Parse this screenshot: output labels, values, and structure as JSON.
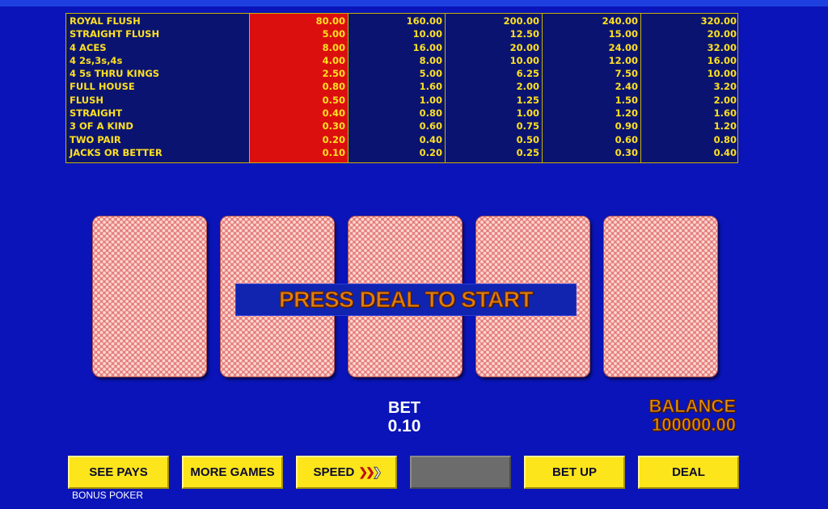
{
  "paytable": {
    "hands": [
      "ROYAL FLUSH",
      "STRAIGHT FLUSH",
      "4 ACES",
      "4 2s,3s,4s",
      "4 5s THRU KINGS",
      "FULL HOUSE",
      "FLUSH",
      "STRAIGHT",
      "3 OF A KIND",
      "TWO PAIR",
      "JACKS OR BETTER"
    ],
    "columns": [
      [
        "80.00",
        "5.00",
        "8.00",
        "4.00",
        "2.50",
        "0.80",
        "0.50",
        "0.40",
        "0.30",
        "0.20",
        "0.10"
      ],
      [
        "160.00",
        "10.00",
        "16.00",
        "8.00",
        "5.00",
        "1.60",
        "1.00",
        "0.80",
        "0.60",
        "0.40",
        "0.20"
      ],
      [
        "200.00",
        "12.50",
        "20.00",
        "10.00",
        "6.25",
        "2.00",
        "1.25",
        "1.00",
        "0.75",
        "0.50",
        "0.25"
      ],
      [
        "240.00",
        "15.00",
        "24.00",
        "12.00",
        "7.50",
        "2.40",
        "1.50",
        "1.20",
        "0.90",
        "0.60",
        "0.30"
      ],
      [
        "320.00",
        "20.00",
        "32.00",
        "16.00",
        "10.00",
        "3.20",
        "2.00",
        "1.60",
        "1.20",
        "0.80",
        "0.40"
      ]
    ],
    "active_column": 0,
    "colors": {
      "text": "#ffe020",
      "background": "#0a1470",
      "active": "#dc0f0f"
    }
  },
  "message": "PRESS DEAL TO START",
  "bet": {
    "label": "BET",
    "value": "0.10"
  },
  "balance": {
    "label": "BALANCE",
    "value": "100000.00"
  },
  "buttons": {
    "see_pays": "SEE PAYS",
    "more_games": "MORE GAMES",
    "speed": "SPEED",
    "bet_up": "BET UP",
    "deal": "DEAL"
  },
  "game_name": "BONUS POKER",
  "cards": [
    "card-back",
    "card-back",
    "card-back",
    "card-back",
    "card-back"
  ]
}
